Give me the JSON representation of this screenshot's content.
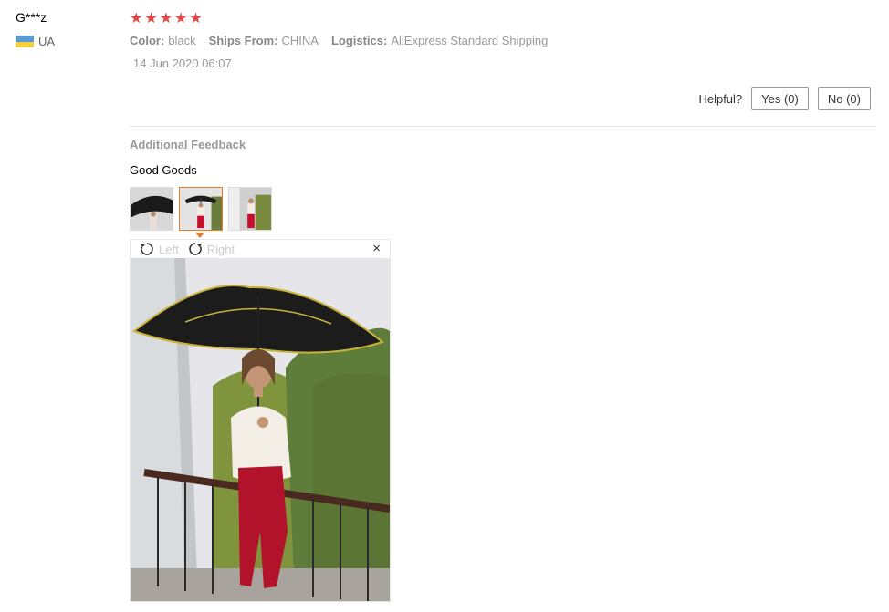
{
  "reviewer": {
    "name": "G***z",
    "country": "UA"
  },
  "rating": {
    "stars": 5,
    "max": 5
  },
  "meta": {
    "color_label": "Color:",
    "color_value": "black",
    "ships_label": "Ships From:",
    "ships_value": "CHINA",
    "logistics_label": "Logistics:",
    "logistics_value": "AliExpress Standard Shipping"
  },
  "date": "14 Jun 2020 06:07",
  "helpful": {
    "label": "Helpful?",
    "yes": "Yes (0)",
    "no": "No (0)"
  },
  "additional": {
    "title": "Additional Feedback",
    "text": "Good Goods"
  },
  "viewer": {
    "left": "Left",
    "right": "Right",
    "close": "×"
  },
  "colors": {
    "star": "#e64545",
    "active_border": "#e27c2e"
  }
}
